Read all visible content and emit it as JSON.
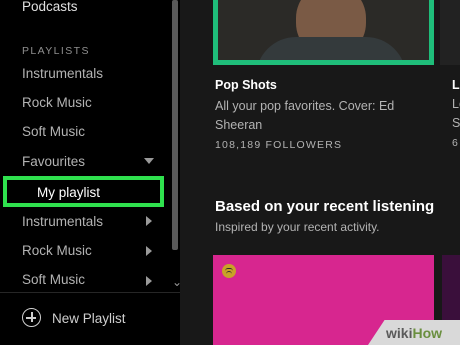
{
  "sidebar": {
    "top_item": "Podcasts",
    "playlists_heading": "PLAYLISTS",
    "items": [
      {
        "label": "Instrumentals"
      },
      {
        "label": "Rock Music"
      },
      {
        "label": "Soft Music"
      },
      {
        "label": "Favourites"
      },
      {
        "label": "My playlist"
      },
      {
        "label": "Instrumentals"
      },
      {
        "label": "Rock Music"
      },
      {
        "label": "Soft Music"
      }
    ],
    "new_playlist": "New Playlist"
  },
  "main": {
    "card": {
      "title": "Pop Shots",
      "description": "All your pop favorites. Cover: Ed Sheeran",
      "followers": "108,189 FOLLOWERS"
    },
    "edge_card": {
      "title": "L",
      "desc1": "Le",
      "desc2": "S",
      "followers": "6"
    },
    "section": {
      "title": "Based on your recent listening",
      "subtitle": "Inspired by your recent activity."
    }
  },
  "watermark": {
    "part1": "wiki",
    "part2": "How"
  },
  "colors": {
    "highlight": "#2fe14e",
    "cover_border": "#1fbd7a",
    "pink_cover": "#d7268f",
    "sidebar_bg": "#000000",
    "main_bg": "#181818"
  }
}
